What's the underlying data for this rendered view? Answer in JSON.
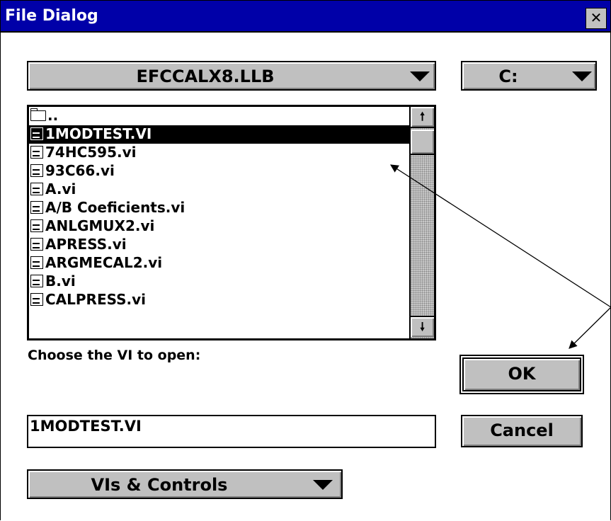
{
  "window": {
    "title": "File Dialog",
    "close_glyph": "✕"
  },
  "path_combo": {
    "value": "EFCCALX8.LLB"
  },
  "drive_combo": {
    "value": "C:"
  },
  "file_list": {
    "parent_entry": "..",
    "items": [
      "1MODTEST.VI",
      "74HC595.vi",
      "93C66.vi",
      "A.vi",
      "A/B Coeficients.vi",
      "ANLGMUX2.vi",
      "APRESS.vi",
      "ARGMECAL2.vi",
      "B.vi",
      "CALPRESS.vi"
    ],
    "selected_index": 0,
    "scroll_up_glyph": "🠕",
    "scroll_down_glyph": "🠗"
  },
  "prompt": {
    "label": "Choose the VI to open:"
  },
  "filename_field": {
    "value": "1MODTEST.VI"
  },
  "buttons": {
    "ok": "OK",
    "cancel": "Cancel"
  },
  "filter_combo": {
    "value": "VIs & Controls"
  },
  "colors": {
    "titlebar": "#0000a8",
    "face": "#c0c0c0",
    "selection": "#000000"
  },
  "icons": [
    "close-icon",
    "dropdown-arrow-icon",
    "folder-icon",
    "vi-file-icon",
    "scroll-up-arrow-icon",
    "scroll-down-arrow-icon"
  ]
}
